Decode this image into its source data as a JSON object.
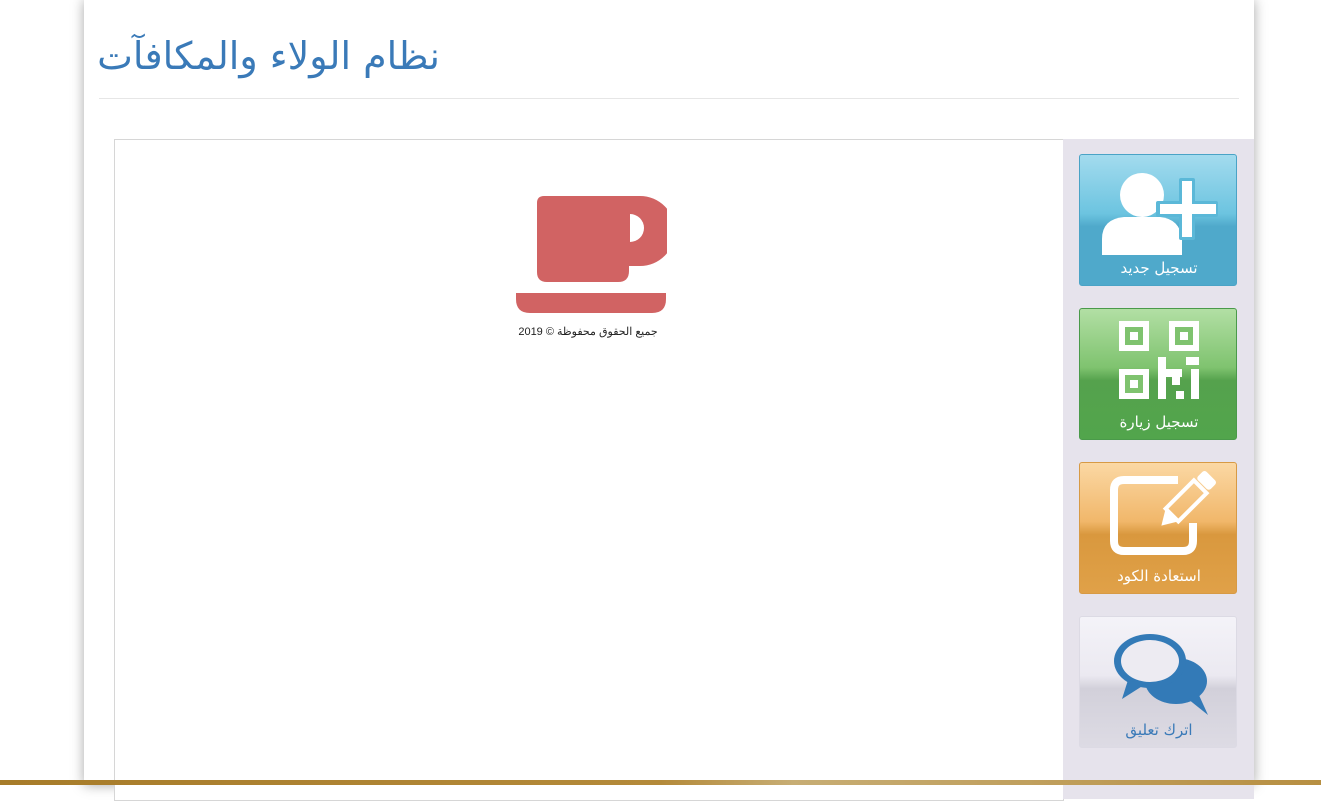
{
  "header": {
    "title": "نظام الولاء والمكافآت"
  },
  "content": {
    "logo_icon": "coffee-cup-icon",
    "copyright": "جميع الحقوق محفوظة © 2019"
  },
  "sidebar": {
    "tiles": [
      {
        "label": "تسجيل جديد",
        "icon": "add-user-icon",
        "color": "#5bc0de"
      },
      {
        "label": "تسجيل زيارة",
        "icon": "qr-code-icon",
        "color": "#5cb85c"
      },
      {
        "label": "استعادة الكود",
        "icon": "edit-icon",
        "color": "#f0ad4e"
      },
      {
        "label": "اترك تعليق",
        "icon": "comments-icon",
        "color": "#337ab7"
      }
    ]
  },
  "colors": {
    "title": "#3a7ab8",
    "logo": "#d16363",
    "panel": "#e6e3ec"
  }
}
